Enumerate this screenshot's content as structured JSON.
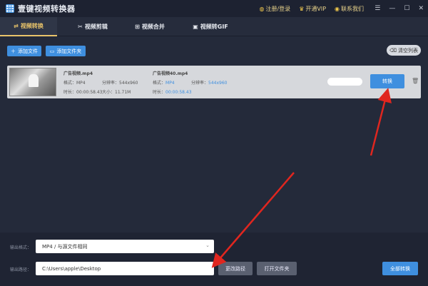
{
  "app": {
    "title": "壹键视频转换器",
    "logo_icon": "grid-logo-icon"
  },
  "top_links": [
    {
      "icon": "user-icon",
      "label": "注册/登录"
    },
    {
      "icon": "crown-icon",
      "label": "开通VIP"
    },
    {
      "icon": "chat-icon",
      "label": "联系我们"
    }
  ],
  "window_controls": {
    "menu": "☰",
    "minimize": "—",
    "maximize": "☐",
    "close": "✕"
  },
  "tabs": [
    {
      "icon": "convert-icon",
      "label": "视频转换",
      "active": true
    },
    {
      "icon": "edit-icon",
      "label": "视频剪辑",
      "active": false
    },
    {
      "icon": "merge-icon",
      "label": "视频合并",
      "active": false
    },
    {
      "icon": "gif-icon",
      "label": "视频转GIF",
      "active": false
    }
  ],
  "toolbar": {
    "add_file": "添加文件",
    "add_folder": "添加文件夹",
    "clear_list": "清空列表"
  },
  "file": {
    "source": {
      "name": "广告视频.mp4",
      "format_label": "格式：MP4",
      "resolution_label": "分辨率：544x960",
      "duration_label": "时长：00:00:58.43",
      "size_label": "大小：11.71M"
    },
    "target": {
      "name": "广告视频40.mp4",
      "format_key": "格式：",
      "format_val": "MP4",
      "resolution_key": "分辨率：",
      "resolution_val": "544x960",
      "duration_key": "时长：",
      "duration_val": "00:00:58.43"
    },
    "progress_pct": 0,
    "convert_button": "转换"
  },
  "output": {
    "format_label": "输出格式：",
    "format_value": "MP4 / 与源文件相同",
    "path_label": "输出路径：",
    "path_value": "C:\\Users\\apple\\Desktop",
    "change_path": "更改路径",
    "open_folder": "打开文件夹",
    "convert_all": "全部转换"
  },
  "colors": {
    "accent": "#3f8fdf",
    "tab_active": "#e9c46a",
    "arrow": "#e0261f"
  }
}
